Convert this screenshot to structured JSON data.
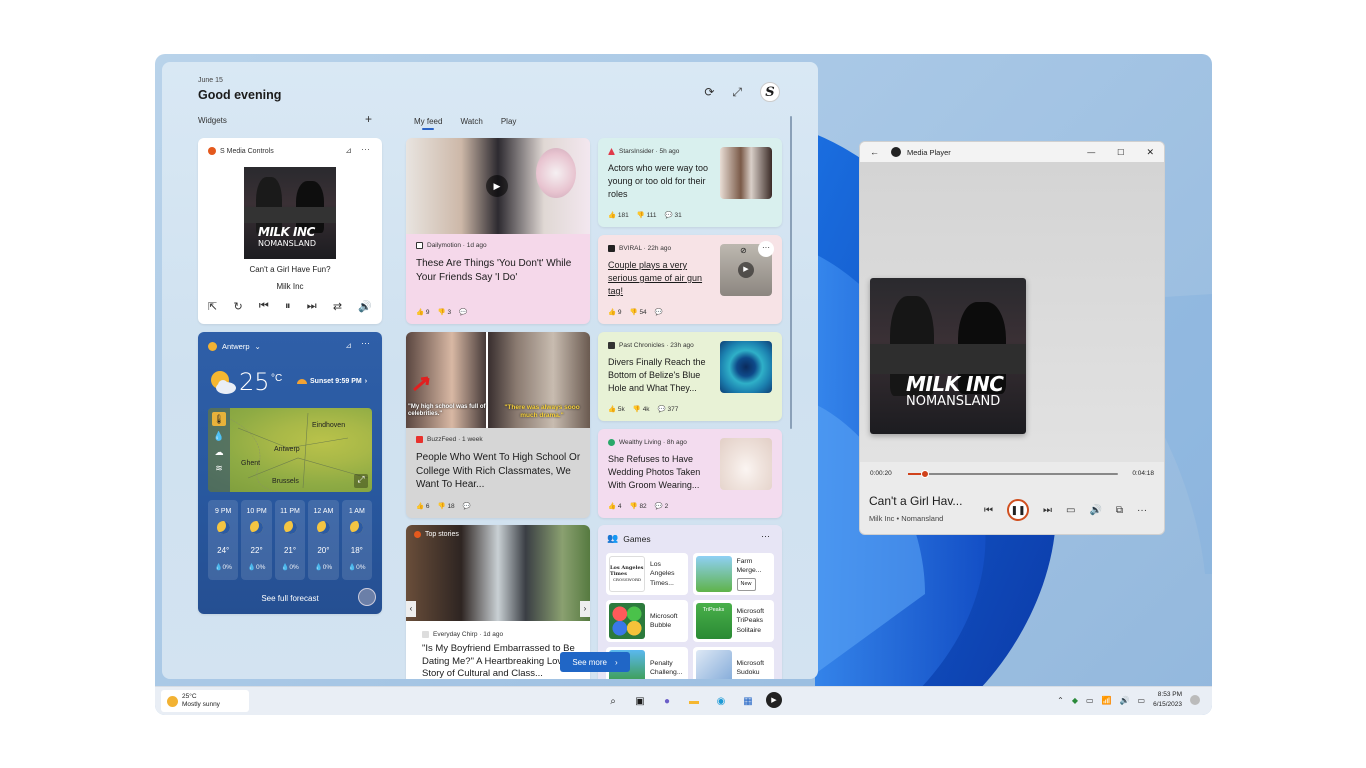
{
  "board": {
    "date": "June 15",
    "greeting": "Good evening",
    "avatar_letter": "S",
    "widgets_label": "Widgets",
    "tabs": [
      "My feed",
      "Watch",
      "Play"
    ],
    "see_more": "See more"
  },
  "media_widget": {
    "header": "S Media Controls",
    "song": "Can't a Girl Have Fun?",
    "artist": "Milk Inc",
    "album_art_text_1": "MILK INC",
    "album_art_text_2": "NOMANSLAND"
  },
  "weather": {
    "city": "Antwerp",
    "temp": "25",
    "unit": "°C",
    "sunset": "Sunset 9:59 PM",
    "map_labels": [
      "Eindhoven",
      "Antwerp",
      "Ghent",
      "Brussels"
    ],
    "forecast": [
      {
        "time": "9 PM",
        "temp": "24°",
        "precip": "0%"
      },
      {
        "time": "10 PM",
        "temp": "22°",
        "precip": "0%"
      },
      {
        "time": "11 PM",
        "temp": "21°",
        "precip": "0%"
      },
      {
        "time": "12 AM",
        "temp": "20°",
        "precip": "0%"
      },
      {
        "time": "1 AM",
        "temp": "18°",
        "precip": "0%"
      }
    ],
    "see_full": "See full forecast"
  },
  "feed": {
    "c1": {
      "source": "Dailymotion · 1d ago",
      "title": "These Are Things 'You Don't' While Your Friends Say 'I Do'",
      "likes": "9",
      "dislikes": "3"
    },
    "c2": {
      "source": "StarsInsider · 5h ago",
      "title": "Actors who were way too young or too old for their roles",
      "likes": "181",
      "dislikes": "111",
      "comments": "31"
    },
    "c3": {
      "source": "BVIRAL · 22h ago",
      "title": "Couple plays a very serious game of air gun tag!",
      "likes": "9",
      "dislikes": "54"
    },
    "c4": {
      "source": "Past Chronicles · 23h ago",
      "title": "Divers Finally Reach the Bottom of Belize's Blue Hole and What They...",
      "likes": "5k",
      "dislikes": "4k",
      "comments": "377"
    },
    "c5": {
      "source": "BuzzFeed · 1 week",
      "title": "People Who Went To High School Or College With Rich Classmates, We Want To Hear...",
      "likes": "6",
      "dislikes": "18",
      "caption_1": "\"My high school was full of celebrities.\"",
      "caption_2": "\"There was always sooo much drama.\""
    },
    "c6": {
      "source": "Wealthy Living · 8h ago",
      "title": "She Refuses to Have Wedding Photos Taken With Groom Wearing...",
      "likes": "4",
      "dislikes": "82",
      "comments": "2"
    },
    "c7": {
      "badge": "Top stories",
      "source": "Everyday Chirp · 1d ago",
      "title": "\"Is My Boyfriend Embarrassed to Be Dating Me?\" A Heartbreaking Love Story of Cultural and Class..."
    },
    "c8": {
      "title": "Games",
      "games": [
        "Los Angeles Times...",
        "Farm Merge...",
        "Microsoft Bubble",
        "Microsoft TriPeaks Solitaire",
        "Penalty Challeng...",
        "Microsoft Sudoku"
      ],
      "new_badge": "New",
      "la_times_logo": "Los Angeles Times",
      "crossword": "CROSSWORD",
      "tripeaks_logo": "TriPeaks"
    }
  },
  "media_player": {
    "title": "Media Player",
    "elapsed": "0:00:20",
    "total": "0:04:18",
    "progress": 0.08,
    "song": "Can't a Girl Hav...",
    "artist": "Milk Inc • Nomansland"
  },
  "taskbar": {
    "temp": "25°C",
    "condition": "Mostly sunny",
    "time": "8:53 PM",
    "date": "6/15/2023"
  },
  "colors": {
    "accent": "#2066c6",
    "weather_bg": "#2b5aa3",
    "media_accent": "#d0421b"
  }
}
